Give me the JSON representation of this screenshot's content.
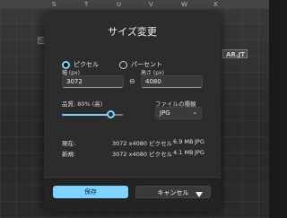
{
  "background": {
    "ruler_letters": [
      "S",
      "T",
      "U",
      "V",
      "W",
      "X"
    ],
    "side_marker": "-",
    "badge_text": "AR.JT"
  },
  "dialog": {
    "title": "サイズ変更",
    "unit_options": [
      {
        "label": "ピクセル",
        "selected": true
      },
      {
        "label": "パーセント",
        "selected": false
      }
    ],
    "width_label": "幅 (px)",
    "width_value": "3072",
    "height_label": "高さ (px)",
    "height_value": "4080",
    "link_icon": "link-icon",
    "quality_label": "品質: 80% (高)",
    "quality_percent": 80,
    "filetype_label": "ファイルの種類",
    "filetype_value": "JPG",
    "current_label": "現在:",
    "current_dims": "3072 x4080 ピクセル",
    "current_size": "6.9 MB",
    "current_format": "JPG",
    "new_label": "新規:",
    "new_dims": "3072 x4080 ピクセル",
    "new_size": "4.1 MB",
    "new_format": "JPG",
    "save_label": "保存",
    "cancel_label": "キャンセル",
    "accent_color": "#7fd3ff"
  }
}
